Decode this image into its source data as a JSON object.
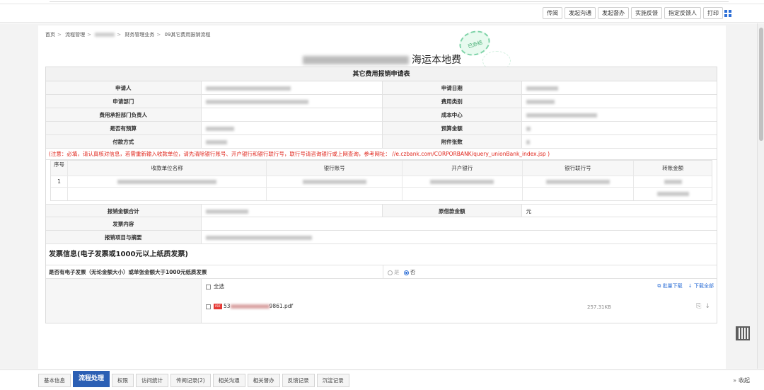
{
  "toolbar": {
    "buttons": [
      "传阅",
      "发起沟通",
      "发起督办",
      "实施反馈",
      "指定反馈人",
      "打印"
    ],
    "layout_icon": "grid-icon"
  },
  "breadcrumb": {
    "home": "首页",
    "process": "流程管理",
    "category": "财务管理业务",
    "current": "09其它费用报销流程"
  },
  "stamp": {
    "text": "已办结"
  },
  "document": {
    "title_suffix": "海运本地费"
  },
  "form": {
    "header": "其它费用报销申请表",
    "rows": [
      {
        "left_label": "申请人",
        "right_label": "申请日期"
      },
      {
        "left_label": "申请部门",
        "right_label": "费用类别"
      },
      {
        "left_label": "费用承担部门负责人",
        "right_label": "成本中心"
      },
      {
        "left_label": "是否有预算",
        "right_label": "预算金额"
      },
      {
        "left_label": "付款方式",
        "right_label": "附件张数"
      }
    ],
    "notice": "(注意：必填，请认真核对信息，若需重新输入收款单位，请先清除银行账号、开户银行和银行联行号，联行号请咨询银行或上网查询，参考网址： //e.czbank.com/CORPORBANK/query_unionBank_index.jsp )",
    "payee_table": {
      "headers": [
        "序号",
        "收款单位名称",
        "银行账号",
        "开户银行",
        "银行联行号",
        "转账金额"
      ],
      "rows": [
        [
          "1",
          "",
          "",
          "",
          "",
          ""
        ]
      ]
    },
    "total_label": "报销金额合计",
    "loan_label": "原借款金额",
    "loan_unit": "元",
    "invoice_content_label": "发票内容",
    "summary_label": "报销项目与摘要"
  },
  "invoice": {
    "section_title": "发票信息(电子发票或1000元以上纸质发票)",
    "question": "是否有电子发票（无论金额大小）或单张金额大于1000元纸质发票",
    "option_yes": "是",
    "option_no": "否",
    "selected": "否",
    "select_all": "全选",
    "batch_download": "批量下载",
    "download_all": "下载全部",
    "files": [
      {
        "name_prefix": "53",
        "name_suffix": "9861.pdf",
        "size": "257.31KB"
      }
    ]
  },
  "bottom_tabs": {
    "items": [
      "基本信息",
      "流程处理",
      "权限",
      "访问统计",
      "传阅记录(2)",
      "相关沟通",
      "相关督办",
      "反馈记录",
      "沉淀记录"
    ],
    "active": "流程处理"
  },
  "collapse_label": "收起"
}
